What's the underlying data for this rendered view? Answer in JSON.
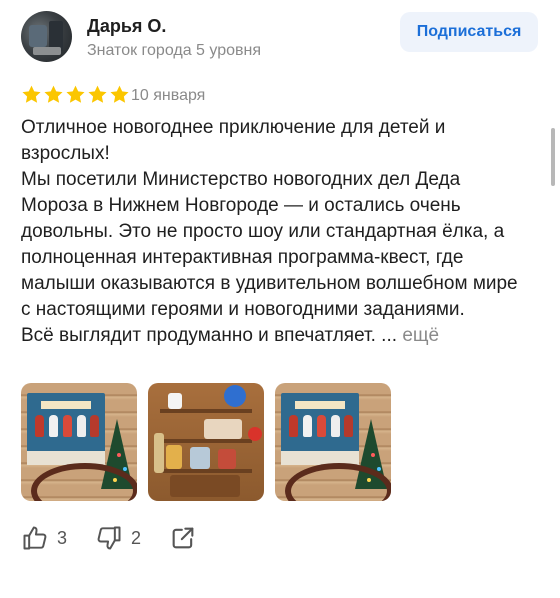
{
  "author": {
    "name": "Дарья О.",
    "level": "Знаток города 5 уровня"
  },
  "subscribe_label": "Подписаться",
  "review": {
    "rating": 5,
    "rating_max": 5,
    "date": "10 января",
    "paragraphs": [
      "Отличное новогоднее приключение для детей и взрослых!",
      "Мы посетили Министерство новогодних дел Деда Мороза в Нижнем Новгороде — и остались очень довольны. Это не просто шоу или стандартная ёлка, а полноценная интерактивная программа-квест, где малыши оказываются в удивительном волшебном мире с настоящими героями и новогодними заданиями.",
      "Всё выглядит продуманно и впечатляет."
    ],
    "ellipsis": " ...",
    "more_label": "ещё"
  },
  "photos": [
    "photo-poster-tree",
    "photo-shelf-toys",
    "photo-poster-tree"
  ],
  "actions": {
    "likes": "3",
    "dislikes": "2"
  },
  "colors": {
    "accent_blue": "#1c6fd8",
    "star_yellow": "#fbc600",
    "muted_text": "#8a8a8a"
  }
}
